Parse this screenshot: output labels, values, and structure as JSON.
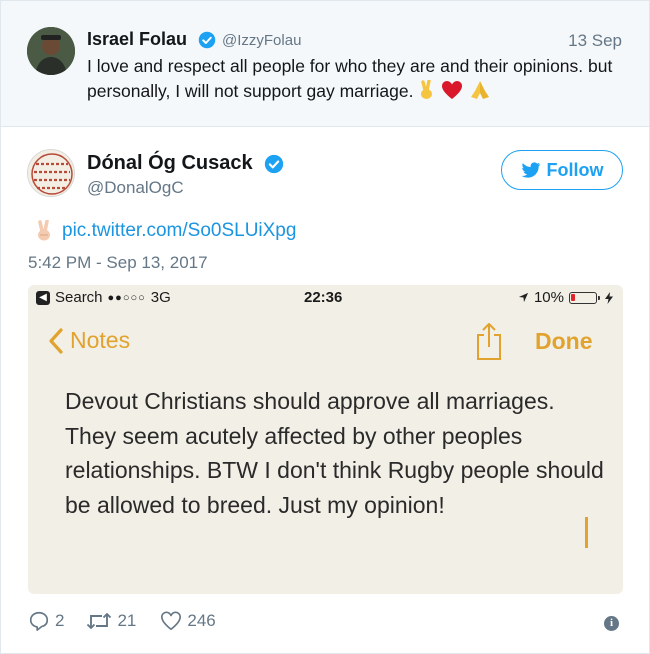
{
  "quoted_tweet": {
    "name": "Israel Folau",
    "handle": "@IzzyFolau",
    "date": "13 Sep",
    "text": "I love and respect all people for who they are and their opinions. but personally, I will not support gay marriage.",
    "emojis": [
      "victory-hand-emoji",
      "red-heart-emoji",
      "folded-hands-emoji"
    ]
  },
  "main_tweet": {
    "name": "Dónal Óg Cusack",
    "handle": "@DonalOgC",
    "follow_label": "Follow",
    "link": "pic.twitter.com/So0SLUiXpg",
    "timestamp": "5:42 PM - Sep 13, 2017",
    "actions": {
      "replies": "2",
      "retweets": "21",
      "likes": "246"
    }
  },
  "phone_screenshot": {
    "status_bar": {
      "back_label": "Search",
      "carrier_signal": "●●○○○",
      "network": "3G",
      "time": "22:36",
      "battery": "10%"
    },
    "nav": {
      "back_label": "Notes",
      "done_label": "Done"
    },
    "note_text": "Devout Christians should approve all marriages. They seem acutely affected by other peoples relationships. BTW I don't think Rugby people should be allowed to breed. Just my opinion!"
  },
  "colors": {
    "twitter_blue": "#1da1f2",
    "link_blue": "#1b95e0",
    "notes_gold": "#e1a32e",
    "muted_gray": "#657786",
    "quoted_bg": "#f5f8fa",
    "notes_bg": "#f2efe6"
  }
}
